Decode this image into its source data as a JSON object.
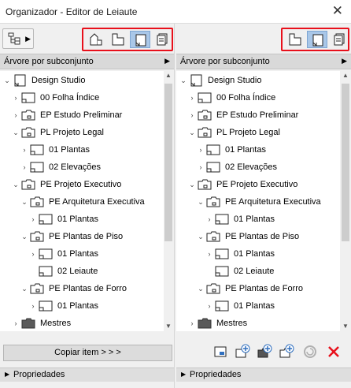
{
  "window": {
    "title": "Organizador - Editor de Leiaute",
    "close_glyph": "✕"
  },
  "left": {
    "subset": "Árvore por subconjunto",
    "copy_button": "Copiar item > > >",
    "properties": "Propriedades",
    "tree": [
      {
        "depth": 0,
        "expander": "open",
        "icon": "layout-book-icon",
        "label": "Design Studio"
      },
      {
        "depth": 1,
        "expander": "closed",
        "icon": "layout-icon",
        "label": "00 Folha Índice"
      },
      {
        "depth": 1,
        "expander": "closed",
        "icon": "subset-folder-icon",
        "label": "EP Estudo Preliminar"
      },
      {
        "depth": 1,
        "expander": "open",
        "icon": "subset-folder-icon",
        "label": "PL Projeto Legal"
      },
      {
        "depth": 2,
        "expander": "closed",
        "icon": "layout-icon",
        "label": "01 Plantas"
      },
      {
        "depth": 2,
        "expander": "closed",
        "icon": "layout-icon",
        "label": "02 Elevações"
      },
      {
        "depth": 1,
        "expander": "open",
        "icon": "subset-folder-icon",
        "label": "PE Projeto Executivo"
      },
      {
        "depth": 2,
        "expander": "open",
        "icon": "subset-folder-icon",
        "label": "PE Arquitetura Executiva"
      },
      {
        "depth": 3,
        "expander": "closed",
        "icon": "layout-icon",
        "label": "01 Plantas"
      },
      {
        "depth": 2,
        "expander": "open",
        "icon": "subset-folder-icon",
        "label": "PE Plantas de Piso"
      },
      {
        "depth": 3,
        "expander": "closed",
        "icon": "layout-icon",
        "label": "01 Plantas"
      },
      {
        "depth": 3,
        "expander": "none",
        "icon": "layout-icon",
        "label": "02 Leiaute"
      },
      {
        "depth": 2,
        "expander": "open",
        "icon": "subset-folder-icon",
        "label": "PE Plantas de Forro"
      },
      {
        "depth": 3,
        "expander": "closed",
        "icon": "layout-icon",
        "label": "01 Plantas"
      },
      {
        "depth": 1,
        "expander": "closed",
        "icon": "master-folder-icon",
        "label": "Mestres"
      }
    ]
  },
  "right": {
    "subset": "Árvore por subconjunto",
    "properties": "Propriedades",
    "tree": [
      {
        "depth": 0,
        "expander": "open",
        "icon": "layout-book-icon",
        "label": "Design Studio"
      },
      {
        "depth": 1,
        "expander": "closed",
        "icon": "layout-icon",
        "label": "00 Folha Índice"
      },
      {
        "depth": 1,
        "expander": "closed",
        "icon": "subset-folder-icon",
        "label": "EP Estudo Preliminar"
      },
      {
        "depth": 1,
        "expander": "open",
        "icon": "subset-folder-icon",
        "label": "PL Projeto Legal"
      },
      {
        "depth": 2,
        "expander": "closed",
        "icon": "layout-icon",
        "label": "01 Plantas"
      },
      {
        "depth": 2,
        "expander": "closed",
        "icon": "layout-icon",
        "label": "02 Elevações"
      },
      {
        "depth": 1,
        "expander": "open",
        "icon": "subset-folder-icon",
        "label": "PE Projeto Executivo"
      },
      {
        "depth": 2,
        "expander": "open",
        "icon": "subset-folder-icon",
        "label": "PE Arquitetura Executiva"
      },
      {
        "depth": 3,
        "expander": "closed",
        "icon": "layout-icon",
        "label": "01 Plantas"
      },
      {
        "depth": 2,
        "expander": "open",
        "icon": "subset-folder-icon",
        "label": "PE Plantas de Piso"
      },
      {
        "depth": 3,
        "expander": "closed",
        "icon": "layout-icon",
        "label": "01 Plantas"
      },
      {
        "depth": 3,
        "expander": "none",
        "icon": "layout-icon",
        "label": "02 Leiaute"
      },
      {
        "depth": 2,
        "expander": "open",
        "icon": "subset-folder-icon",
        "label": "PE Plantas de Forro"
      },
      {
        "depth": 3,
        "expander": "closed",
        "icon": "layout-icon",
        "label": "01 Plantas"
      },
      {
        "depth": 1,
        "expander": "closed",
        "icon": "master-folder-icon",
        "label": "Mestres"
      }
    ]
  },
  "colors": {
    "highlight_border": "#e8101b",
    "active_view": "#a9c7e8",
    "delete_red": "#e8101b"
  },
  "view_buttons": {
    "left": [
      "project-map-icon",
      "view-map-icon",
      "layout-book-view-icon",
      "publisher-sets-icon"
    ],
    "left_active": "layout-book-view-icon",
    "right": [
      "view-map-icon",
      "layout-book-view-icon",
      "publisher-sets-icon"
    ],
    "right_active": "layout-book-view-icon"
  },
  "right_actions": [
    "layout-settings-icon",
    "new-layout-icon",
    "new-master-icon",
    "new-subset-icon",
    "update-icon",
    "delete-icon"
  ]
}
